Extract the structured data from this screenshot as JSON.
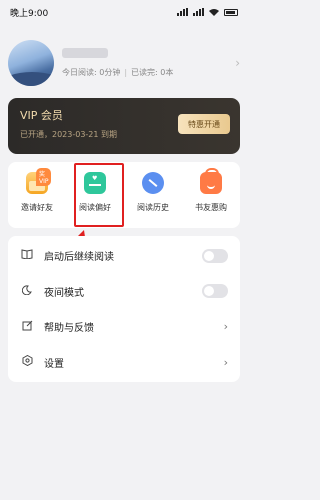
{
  "status_bar": {
    "time": "晚上9:00"
  },
  "profile": {
    "reading_today": "今日阅读: 0分钟",
    "read_complete": "已读完: 0本",
    "separator": "|"
  },
  "vip": {
    "title": "VIP 会员",
    "subtitle": "已开通，2023-03-21 到期",
    "button": "特惠开通"
  },
  "shortcuts": [
    {
      "label": "邀请好友",
      "badge": "奖VIP",
      "icon": "gift-envelope-icon"
    },
    {
      "label": "阅读偏好",
      "icon": "reading-preference-icon"
    },
    {
      "label": "阅读历史",
      "icon": "reading-history-icon"
    },
    {
      "label": "书友惠购",
      "icon": "shopping-bag-icon"
    }
  ],
  "settings": [
    {
      "label": "启动后继续阅读",
      "icon": "book-icon",
      "control": "toggle",
      "on": false
    },
    {
      "label": "夜间模式",
      "icon": "moon-icon",
      "control": "toggle",
      "on": false
    },
    {
      "label": "帮助与反馈",
      "icon": "edit-icon",
      "control": "chevron"
    },
    {
      "label": "设置",
      "icon": "settings-icon",
      "control": "chevron"
    }
  ],
  "colors": {
    "highlight": "#e02020",
    "vip_gold": "#f1d7a6"
  }
}
